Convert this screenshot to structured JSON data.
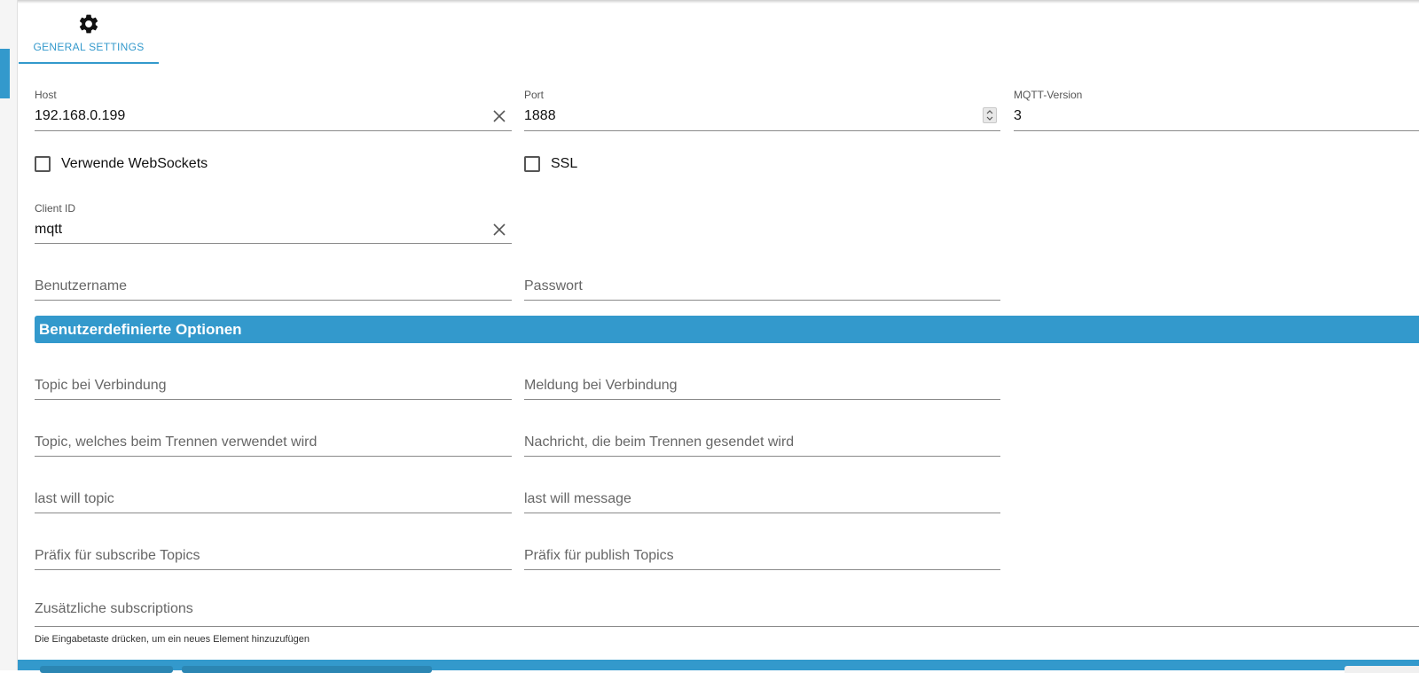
{
  "tabs": [
    {
      "label": "GENERAL SETTINGS",
      "icon": "gear-icon",
      "active": true
    }
  ],
  "general": {
    "host": {
      "label": "Host",
      "value": "192.168.0.199"
    },
    "port": {
      "label": "Port",
      "value": "1888"
    },
    "mqtt_version": {
      "label": "MQTT-Version",
      "value": "3"
    },
    "websockets": {
      "label": "Verwende WebSockets",
      "checked": false
    },
    "ssl": {
      "label": "SSL",
      "checked": false
    },
    "client_id": {
      "label": "Client ID",
      "value": "mqtt"
    },
    "username": {
      "placeholder": "Benutzername"
    },
    "password": {
      "placeholder": "Passwort"
    }
  },
  "custom_options": {
    "title": "Benutzerdefinierte Optionen",
    "connect_topic": {
      "placeholder": "Topic bei Verbindung"
    },
    "connect_message": {
      "placeholder": "Meldung bei Verbindung"
    },
    "disconnect_topic": {
      "placeholder": "Topic, welches beim Trennen verwendet wird"
    },
    "disconnect_message": {
      "placeholder": "Nachricht, die beim Trennen gesendet wird"
    },
    "last_will_topic": {
      "placeholder": "last will topic"
    },
    "last_will_message": {
      "placeholder": "last will message"
    },
    "subscribe_prefix": {
      "placeholder": "Präfix für subscribe Topics"
    },
    "publish_prefix": {
      "placeholder": "Präfix für publish Topics"
    },
    "subscriptions": {
      "placeholder": "Zusätzliche subscriptions",
      "helper": "Die Eingabetaste drücken, um ein neues Element hinzuzufügen"
    }
  },
  "colors": {
    "accent": "#3399cc",
    "underline": "#8a8a8a"
  }
}
